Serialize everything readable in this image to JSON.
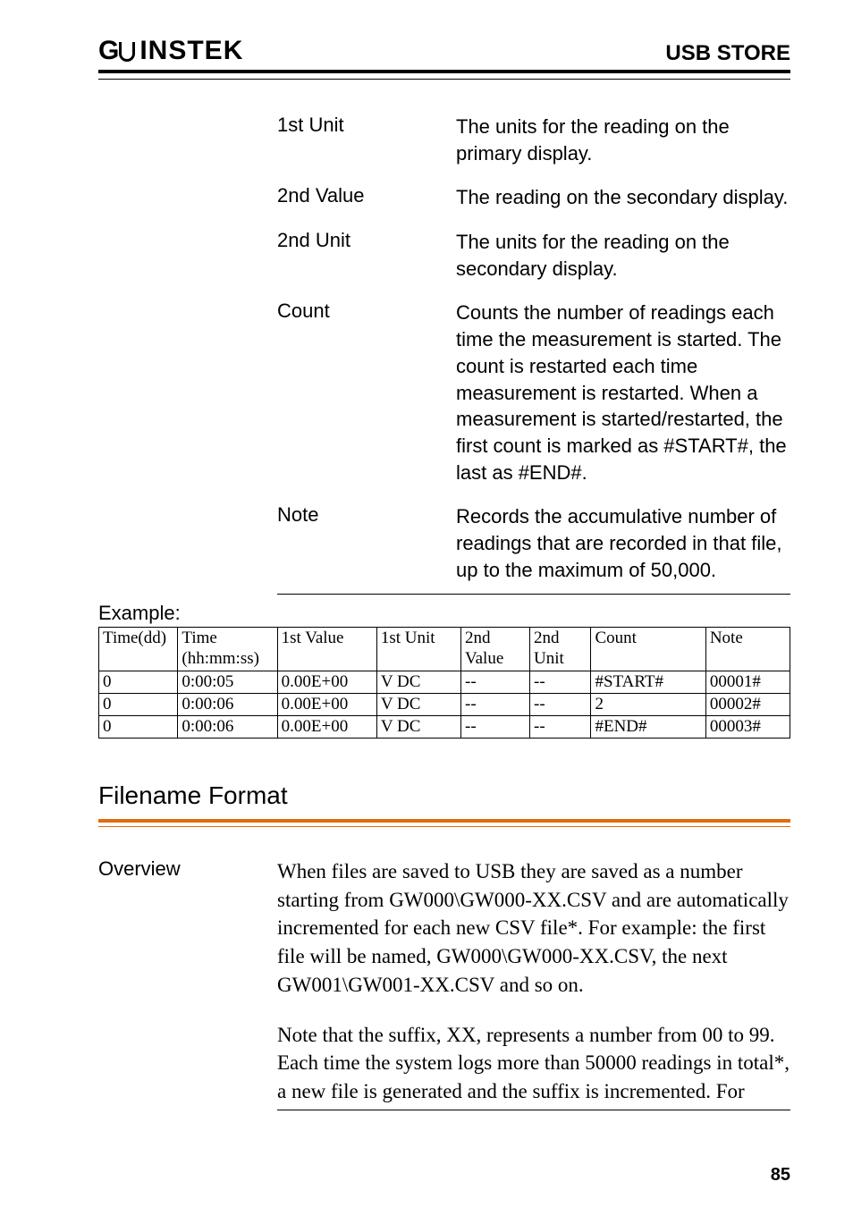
{
  "header": {
    "brand_prefix": "G",
    "brand_suffix": "INSTEK",
    "section": "USB STORE"
  },
  "defs": [
    {
      "term": "1st Unit",
      "desc": "The units for the reading on the primary display."
    },
    {
      "term": "2nd Value",
      "desc": "The reading on the secondary display."
    },
    {
      "term": "2nd Unit",
      "desc": "The units for the reading on the secondary display."
    },
    {
      "term": "Count",
      "desc": "Counts the number of readings each time the measurement is started. The count is restarted each time measurement is restarted. When a measurement is started/restarted, the first count is marked as #START#, the last as #END#."
    },
    {
      "term": "Note",
      "desc": "Records the accumulative number of readings that are recorded in that file, up to the maximum of 50,000."
    }
  ],
  "example_label": "Example:",
  "table": {
    "headers": {
      "c1": "Time(dd)",
      "c2a": "Time",
      "c2b": "(hh:mm:ss)",
      "c3": "1st Value",
      "c4": "1st Unit",
      "c5a": "2nd",
      "c5b": "Value",
      "c6a": "2nd",
      "c6b": "Unit",
      "c7": "Count",
      "c8": "Note"
    },
    "rows": [
      {
        "c1": "0",
        "c2": "0:00:05",
        "c3": "0.00E+00",
        "c4": "V DC",
        "c5": "--",
        "c6": "--",
        "c7": "#START#",
        "c8": "00001#"
      },
      {
        "c1": "0",
        "c2": "0:00:06",
        "c3": "0.00E+00",
        "c4": "V DC",
        "c5": "--",
        "c6": "--",
        "c7": "2",
        "c8": "00002#"
      },
      {
        "c1": "0",
        "c2": "0:00:06",
        "c3": "0.00E+00",
        "c4": "V DC",
        "c5": "--",
        "c6": "--",
        "c7": "#END#",
        "c8": "00003#"
      }
    ]
  },
  "filename_heading": "Filename Format",
  "overview": {
    "label": "Overview",
    "p1": "When files are saved to USB they are saved as a number starting from GW000\\GW000-XX.CSV and are automatically incremented for each new CSV file*. For example: the first file will be named, GW000\\GW000-XX.CSV, the next GW001\\GW001-XX.CSV and so on.",
    "p2": "Note that the suffix, XX, represents a number from 00 to 99. Each time the system logs more than 50000 readings in total*, a new file is generated and the suffix is incremented. For"
  },
  "page_number": "85"
}
